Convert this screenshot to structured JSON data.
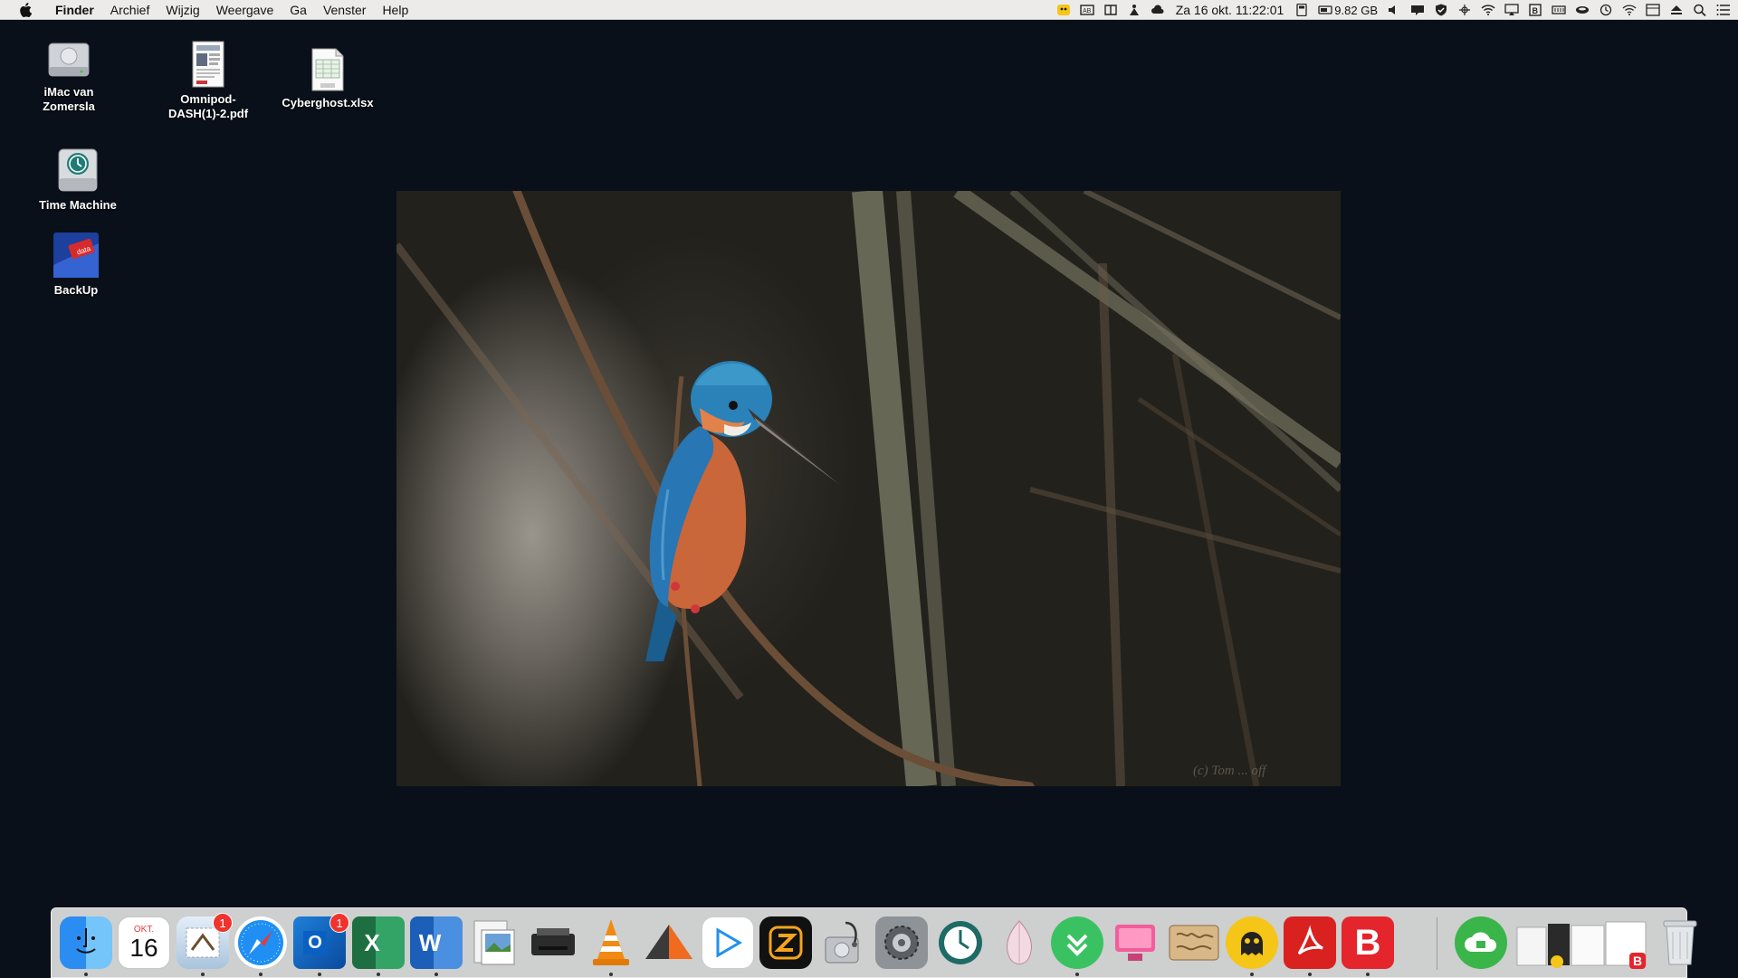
{
  "menubar": {
    "app_name": "Finder",
    "items": [
      "Archief",
      "Wijzig",
      "Weergave",
      "Ga",
      "Venster",
      "Help"
    ],
    "clock": "Za 16 okt.  11:22:01",
    "storage": "9.82 GB"
  },
  "desktop_icons": [
    {
      "label": "iMac van\nZomersla",
      "icon": "hard-drive-icon"
    },
    {
      "label": "Omnipod-\nDASH(1)-2.pdf",
      "icon": "pdf-document-icon"
    },
    {
      "label": "Cyberghost.xlsx",
      "icon": "spreadsheet-document-icon"
    },
    {
      "label": "Time Machine",
      "icon": "time-machine-drive-icon"
    },
    {
      "label": "BackUp",
      "icon": "backup-drive-icon"
    }
  ],
  "wallpaper": {
    "subject": "kingfisher-photo",
    "watermark": "(c) Tom ... off"
  },
  "calendar_icon": {
    "month": "OKT.",
    "day": "16"
  },
  "dock": {
    "mail_badge": "1",
    "outlook_badge": "1",
    "apps": [
      "finder",
      "calendar",
      "mail",
      "safari",
      "outlook",
      "excel",
      "word",
      "preview",
      "printer",
      "vlc",
      "migration",
      "infuse",
      "zattoo",
      "disk-utility",
      "system-preferences",
      "time-machine",
      "garlic",
      "feedly",
      "cleanmymac",
      "maps",
      "cyberghost",
      "acrobat",
      "bitdefender",
      "dropzone",
      "documents-stack",
      "trash"
    ]
  },
  "colors": {
    "desktop_bg": "#0a1019",
    "menubar_bg": "#ecebea",
    "dock_bg": "#dedede"
  }
}
